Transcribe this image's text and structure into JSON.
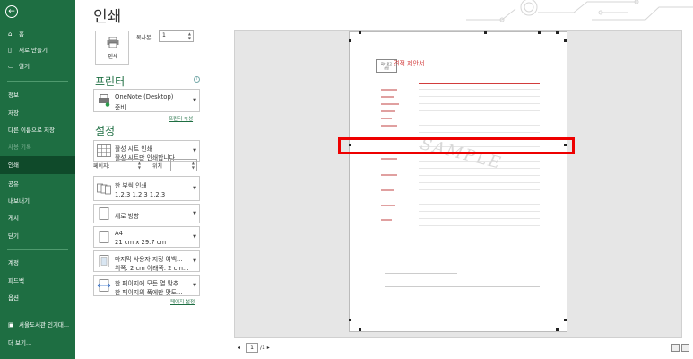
{
  "sidebar": {
    "items": [
      {
        "label": "홈",
        "icon": "home-icon"
      },
      {
        "label": "새로 만들기",
        "icon": "new-document-icon"
      },
      {
        "label": "열기",
        "icon": "folder-open-icon"
      },
      {
        "label": "정보"
      },
      {
        "label": "저장"
      },
      {
        "label": "다른 이름으로 저장"
      },
      {
        "label": "사용 기록"
      },
      {
        "label": "인쇄"
      },
      {
        "label": "공유"
      },
      {
        "label": "내보내기"
      },
      {
        "label": "게시"
      },
      {
        "label": "닫기"
      },
      {
        "label": "계정"
      },
      {
        "label": "피드백"
      },
      {
        "label": "옵션"
      },
      {
        "label": "서울도서관 인기대..."
      },
      {
        "label": "더 보기..."
      }
    ],
    "bg_color": "#1e6e42"
  },
  "main": {
    "title": "인쇄",
    "print_button_label": "인쇄",
    "copies_label": "복사본:",
    "copies_value": "1",
    "printer_heading": "프린터",
    "printer_name": "OneNote (Desktop)",
    "printer_status": "준비",
    "printer_properties_link": "프린터 속성",
    "settings_heading": "설정",
    "settings": [
      {
        "line1": "활성 시트 인쇄",
        "line2": "활성 시트만 인쇄합니다."
      },
      {
        "line1": "한 부씩 인쇄",
        "line2": "1,2,3    1,2,3    1,2,3"
      },
      {
        "line1": "세로 방향",
        "line2": ""
      },
      {
        "line1": "A4",
        "line2": "21 cm x 29.7 cm"
      },
      {
        "line1": "마지막 사용자 지정 여백...",
        "line2": "위쪽: 2 cm 아래쪽: 2 cm..."
      },
      {
        "line1": "한 페이지에 모든 열 맞추...",
        "line2": "한 페이지의 폭에만 맞도..."
      }
    ],
    "pages_label": "페이지:",
    "pages_to_label": "위치",
    "page_setup_link": "페이지 설정"
  },
  "preview": {
    "doc_title": "견적 제안서",
    "logo_text": [
      "회사 로고",
      "삽입"
    ],
    "watermark": "SAMPLE",
    "page_current": "1",
    "page_total": "/1 ▸",
    "page_prev": "◂",
    "highlight_color": "#ee0000"
  }
}
